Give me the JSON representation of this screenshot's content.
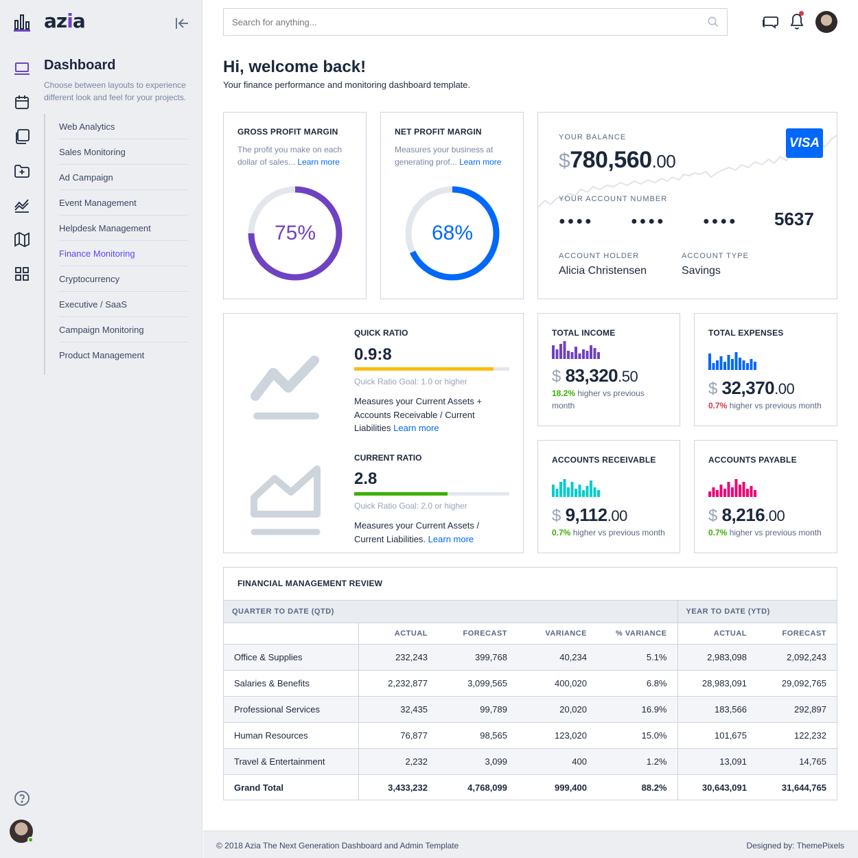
{
  "brand": {
    "name_left": "az",
    "name_accent": "i",
    "name_right": "a",
    "accent_color": "#6f42c1"
  },
  "sidebar": {
    "title": "Dashboard",
    "description": "Choose between layouts to experience different look and feel for your projects.",
    "rail_icons": [
      "laptop-icon",
      "calendar-icon",
      "layers-icon",
      "folder-plus-icon",
      "activity-icon",
      "map-icon",
      "grid-icon"
    ],
    "items": [
      {
        "label": "Web Analytics"
      },
      {
        "label": "Sales Monitoring"
      },
      {
        "label": "Ad Campaign"
      },
      {
        "label": "Event Management"
      },
      {
        "label": "Helpdesk Management"
      },
      {
        "label": "Finance Monitoring",
        "active": true
      },
      {
        "label": "Cryptocurrency"
      },
      {
        "label": "Executive / SaaS"
      },
      {
        "label": "Campaign Monitoring"
      },
      {
        "label": "Product Management"
      }
    ]
  },
  "header": {
    "search_placeholder": "Search for anything..."
  },
  "welcome": {
    "title": "Hi, welcome back!",
    "subtitle": "Your finance performance and monitoring dashboard template."
  },
  "gross": {
    "label": "GROSS PROFIT MARGIN",
    "desc": "The profit you make on each dollar of sales...",
    "link": "Learn more",
    "value_text": "75%",
    "value": 0.75,
    "color": "#6f42c1"
  },
  "net": {
    "label": "NET PROFIT MARGIN",
    "desc": "Measures your business at generating prof...",
    "link": "Learn more",
    "value_text": "68%",
    "value": 0.68,
    "color": "#0168fa"
  },
  "balance": {
    "label": "YOUR BALANCE",
    "currency": "$",
    "amount": "780,560",
    "cents": ".00",
    "card_brand": "VISA",
    "account_label": "YOUR ACCOUNT NUMBER",
    "masked": "●●●●",
    "last4": "5637",
    "holder_label": "ACCOUNT HOLDER",
    "holder": "Alicia Christensen",
    "type_label": "ACCOUNT TYPE",
    "type": "Savings"
  },
  "quick": {
    "title": "QUICK RATIO",
    "value": "0.9:8",
    "fill": 0.9,
    "color": "#fbbc0b",
    "goal": "Quick Ratio Goal: 1.0 or higher",
    "desc": "Measures your Current Assets + Accounts Receivable / Current Liabilities",
    "link": "Learn more"
  },
  "current": {
    "title": "CURRENT RATIO",
    "value": "2.8",
    "fill": 0.6,
    "color": "#3bb001",
    "goal": "Quick Ratio Goal: 2.0 or higher",
    "desc": "Measures your Current Assets / Current Liabilities.",
    "link": "Learn more"
  },
  "income": {
    "title": "TOTAL INCOME",
    "currency": "$",
    "amount": "83,320",
    "cents": ".50",
    "pct": "18.2%",
    "note": "higher vs previous month",
    "trend": "up",
    "color": "#6f42c1"
  },
  "expenses": {
    "title": "TOTAL EXPENSES",
    "currency": "$",
    "amount": "32,370",
    "cents": ".00",
    "pct": "0.7%",
    "note": "higher vs previous month",
    "trend": "down",
    "color": "#0168fa"
  },
  "receivable": {
    "title": "ACCOUNTS RECEIVABLE",
    "currency": "$",
    "amount": "9,112",
    "cents": ".00",
    "pct": "0.7%",
    "note": "higher vs previous month",
    "trend": "up",
    "color": "#00cccc"
  },
  "payable": {
    "title": "ACCOUNTS PAYABLE",
    "currency": "$",
    "amount": "8,216",
    "cents": ".00",
    "pct": "0.7%",
    "note": "higher vs previous month",
    "trend": "up",
    "color": "#f10075"
  },
  "review": {
    "title": "FINANCIAL MANAGEMENT REVIEW",
    "group_qtd": "QUARTER TO DATE (QTD)",
    "group_ytd": "YEAR TO DATE (YTD)",
    "columns": [
      "ACTUAL",
      "FORECAST",
      "VARIANCE",
      "% VARIANCE",
      "ACTUAL",
      "FORECAST"
    ],
    "rows": [
      [
        "Office & Supplies",
        "232,243",
        "399,768",
        "40,234",
        "5.1%",
        "2,983,098",
        "2,092,243"
      ],
      [
        "Salaries & Benefits",
        "2,232,877",
        "3,099,565",
        "400,020",
        "6.8%",
        "28,983,091",
        "29,092,765"
      ],
      [
        "Professional Services",
        "32,435",
        "99,789",
        "20,020",
        "16.9%",
        "183,566",
        "292,897"
      ],
      [
        "Human Resources",
        "76,877",
        "98,565",
        "123,020",
        "15.0%",
        "101,675",
        "122,232"
      ],
      [
        "Travel & Entertainment",
        "2,232",
        "3,099",
        "400",
        "1.2%",
        "13,091",
        "14,765"
      ],
      [
        "Grand Total",
        "3,433,232",
        "4,768,099",
        "999,400",
        "88.2%",
        "30,643,091",
        "31,644,765"
      ]
    ]
  },
  "footer": {
    "left": "© 2018 Azia The Next Generation Dashboard and Admin Template",
    "right": "Designed by: ThemePixels"
  }
}
